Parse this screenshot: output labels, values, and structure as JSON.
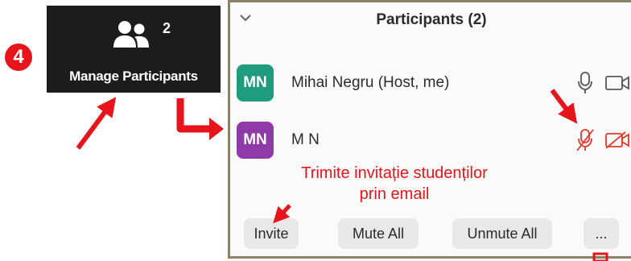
{
  "step_badge": "4",
  "zoom_button": {
    "count": "2",
    "label": "Manage Participants"
  },
  "panel": {
    "title": "Participants (2)",
    "participants": [
      {
        "initials": "MN",
        "name": "Mihai Negru (Host, me)",
        "avatar_color": "#1f9c7d",
        "muted": false
      },
      {
        "initials": "MN",
        "name": "M N",
        "avatar_color": "#8e3aa8",
        "muted": true
      }
    ],
    "buttons": {
      "invite": "Invite",
      "mute_all": "Mute All",
      "unmute_all": "Unmute All",
      "more": "..."
    }
  },
  "annotation": {
    "line1": "Trimite invitație studenților",
    "line2": "prin email"
  },
  "colors": {
    "annotation_red": "#e8141b",
    "dark_button": "#1c1c1c",
    "panel_border": "#8c8163"
  },
  "icons": [
    "people-icon",
    "chevron-down-icon",
    "microphone-icon",
    "camera-icon",
    "microphone-muted-icon",
    "camera-off-icon",
    "red-arrow"
  ]
}
